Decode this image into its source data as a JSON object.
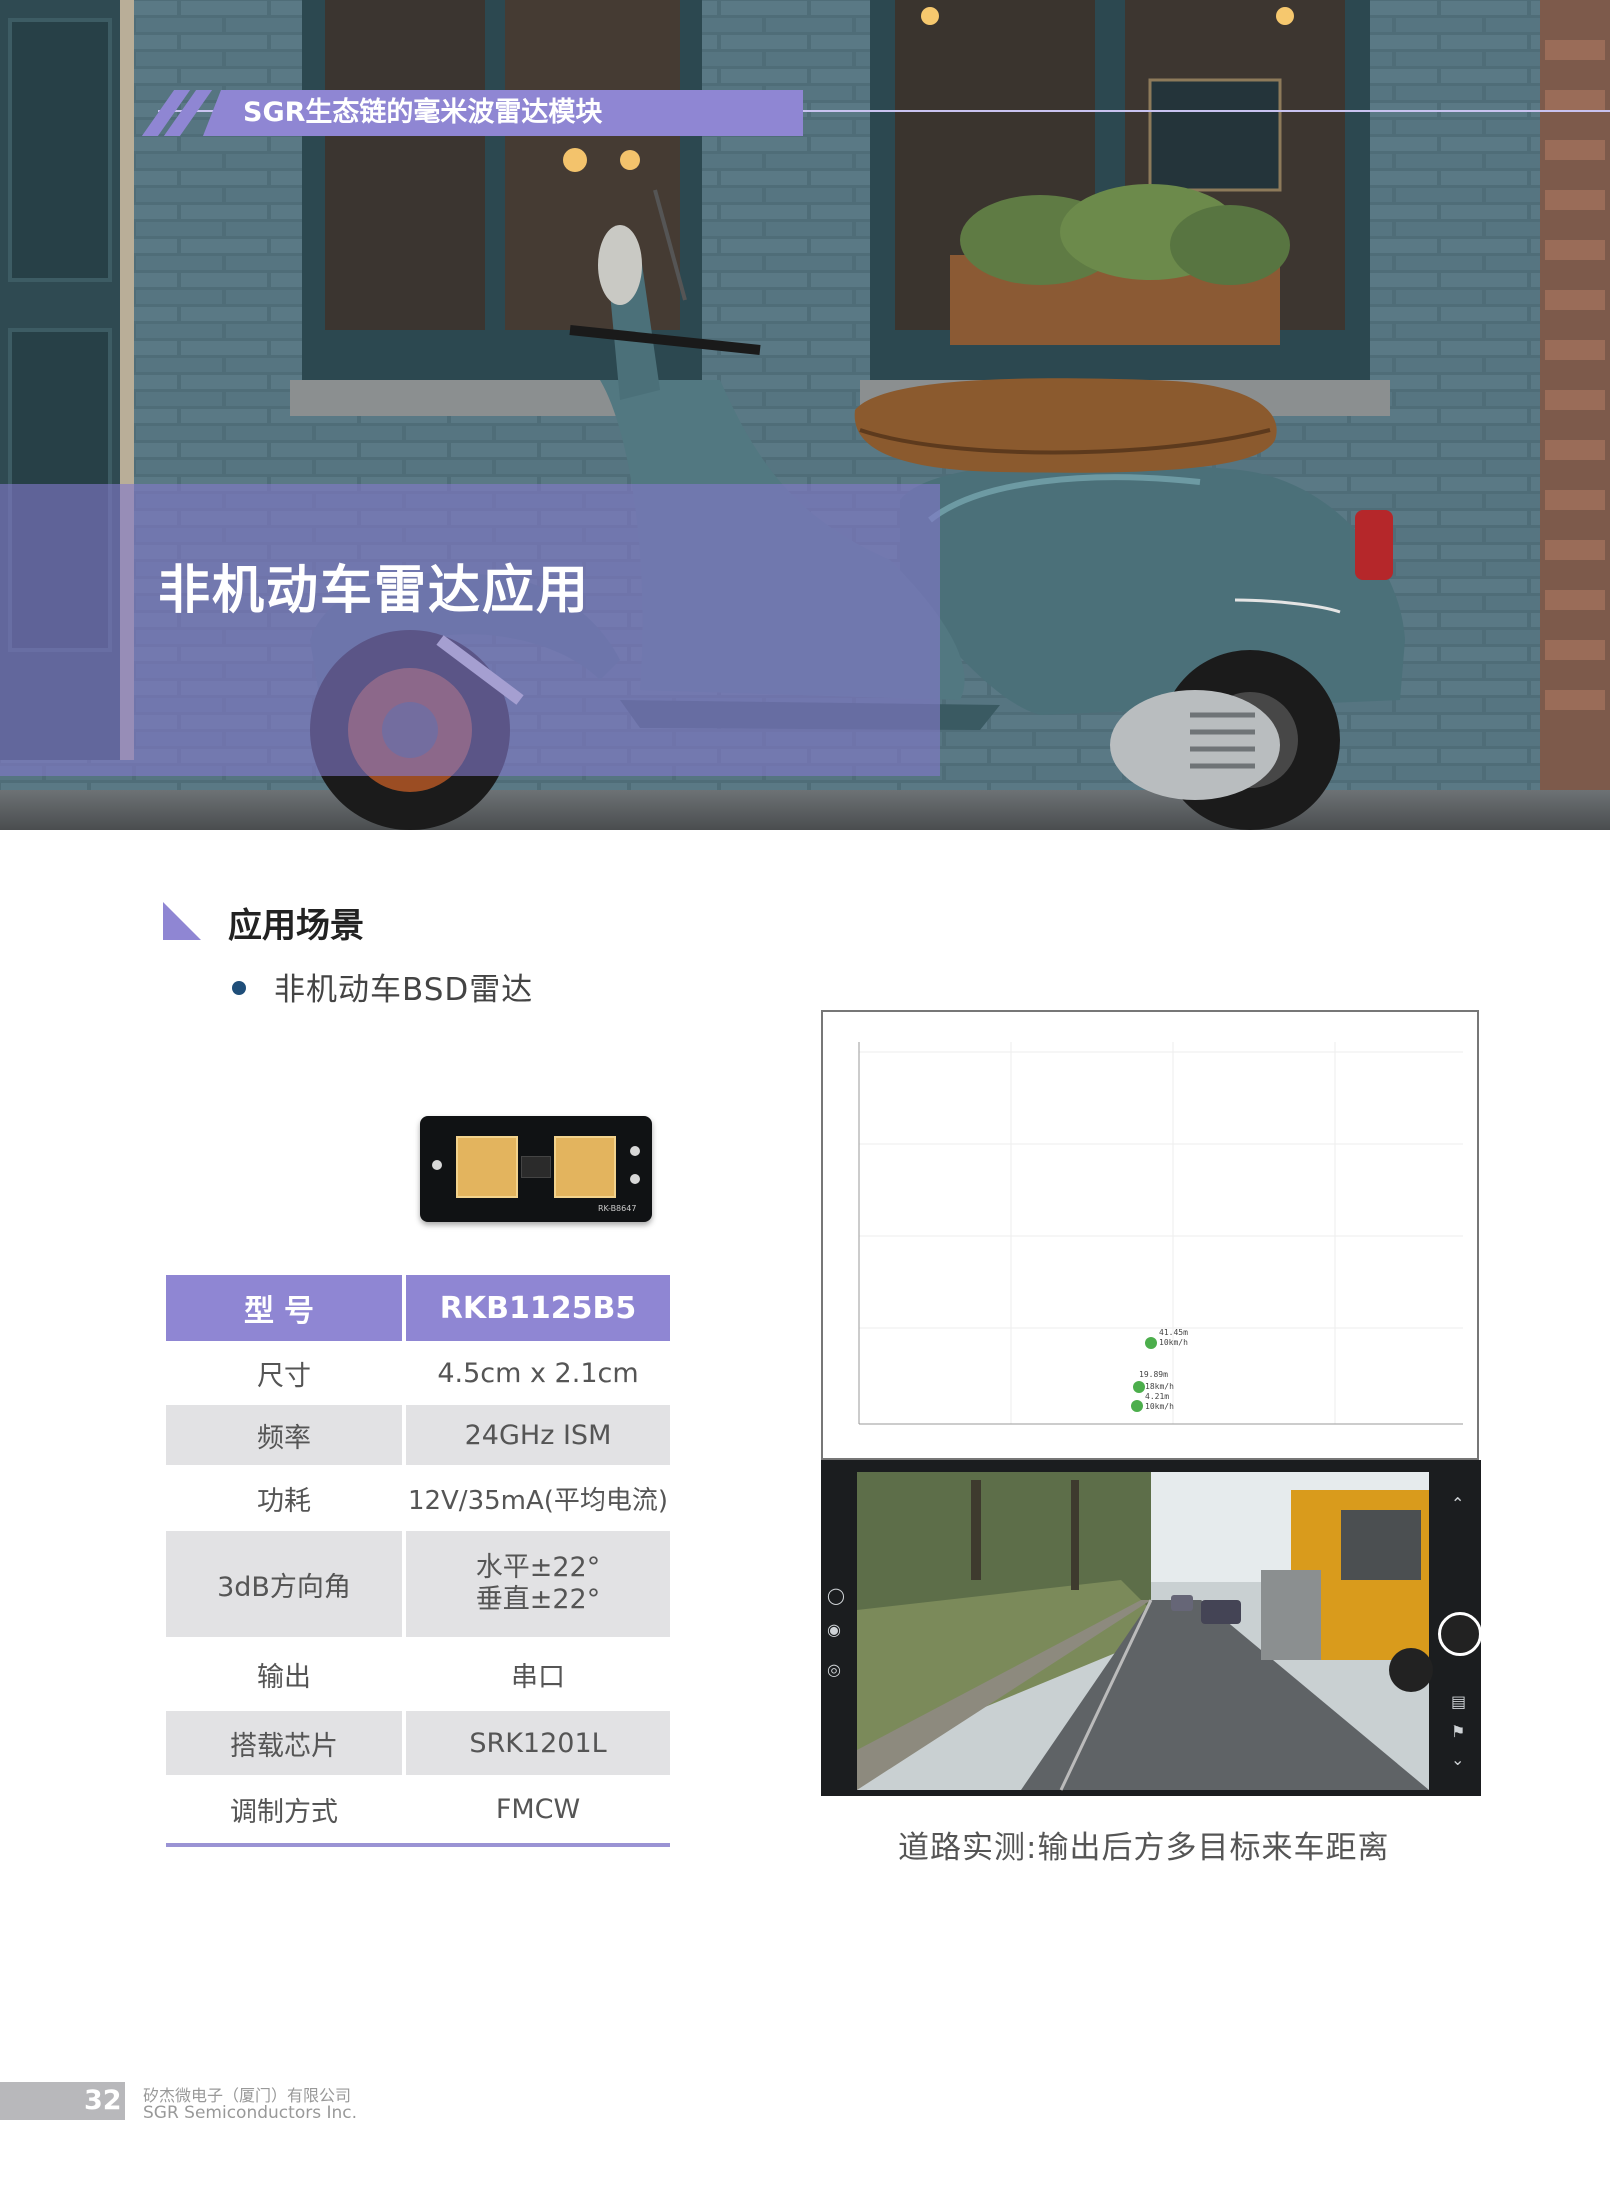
{
  "hero": {
    "tag": "SGR生态链的毫米波雷达模块",
    "title": "非机动车雷达应用"
  },
  "section": {
    "title": "应用场景",
    "bullets": [
      "非机动车BSD雷达"
    ]
  },
  "module_image": {
    "marking": "RK-B8647"
  },
  "spec_table": {
    "header": [
      "型号",
      "RKB1125B5"
    ],
    "rows": [
      {
        "label": "尺寸",
        "value": "4.5cm x 2.1cm"
      },
      {
        "label": "频率",
        "value": "24GHz ISM"
      },
      {
        "label": "功耗",
        "value": "12V/35mA(平均电流)"
      },
      {
        "label": "3dB方向角",
        "value_lines": [
          "水平±22°",
          "垂直±22°"
        ]
      },
      {
        "label": "输出",
        "value": "串口"
      },
      {
        "label": "搭载芯片",
        "value": "SRK1201L"
      },
      {
        "label": "调制方式",
        "value": "FMCW"
      }
    ]
  },
  "radar_plot": {
    "targets": [
      {
        "label": "41.45m",
        "sub": "10km/h"
      },
      {
        "label": "19.89m",
        "sub": "18km/h"
      },
      {
        "label": "4.21m",
        "sub": "10km/h"
      }
    ],
    "colors": {
      "point": "#4cae4c",
      "grid": "#e6e6e6",
      "axis": "#888888"
    }
  },
  "camera_view": {
    "icons": [
      "timer-off-icon",
      "camera-settings-icon",
      "filter-icon",
      "chevron-up-icon",
      "shutter-button",
      "document-icon",
      "flag-icon",
      "chevron-down-icon"
    ]
  },
  "caption": "道路实测:输出后方多目标来车距离",
  "footer": {
    "page_number": "32",
    "company_cn": "矽杰微电子（厦门）有限公司",
    "company_en": "SGR Semiconductors Inc."
  },
  "colors": {
    "accent": "#8f86d3",
    "bullet": "#1f4e79",
    "shade": "#e2e2e4"
  }
}
